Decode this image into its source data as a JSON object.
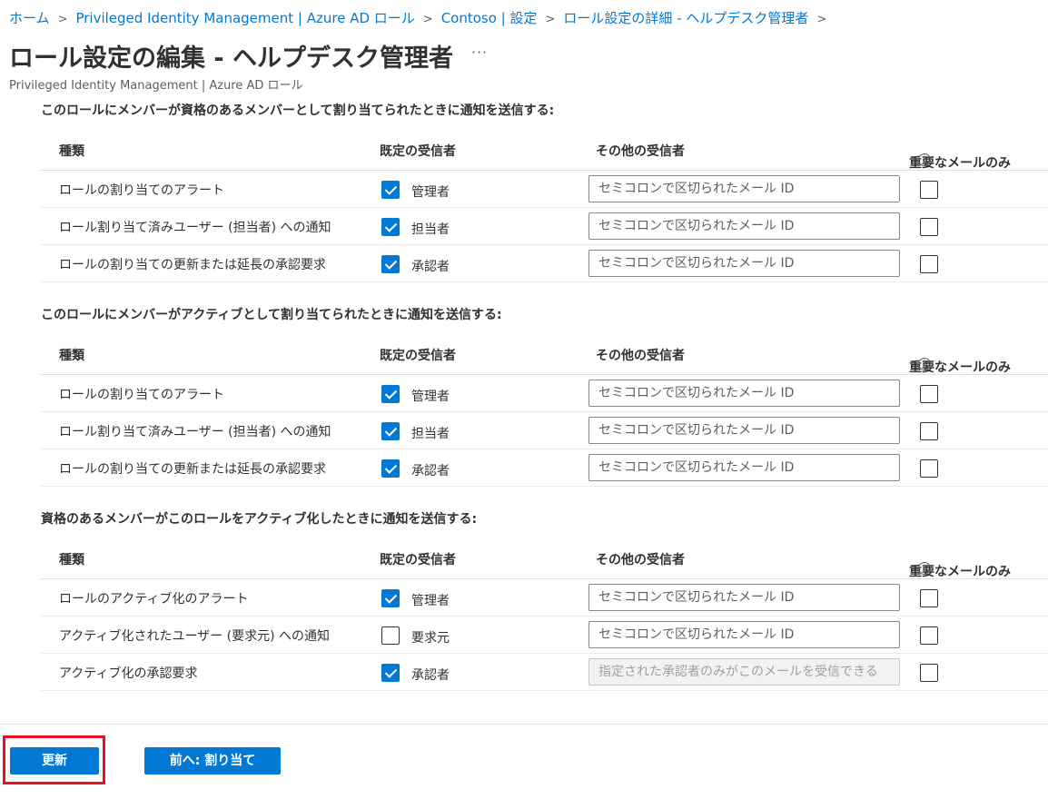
{
  "breadcrumb": [
    "ホーム",
    "Privileged Identity Management | Azure AD ロール",
    "Contoso | 設定",
    "ロール設定の詳細 - ヘルプデスク管理者"
  ],
  "breadcrumb_separator": ">",
  "title": "ロール設定の編集 - ヘルプデスク管理者",
  "more_label": "···",
  "subtitle": "Privileged Identity Management | Azure AD ロール",
  "columns": {
    "type": "種類",
    "default_recipients": "既定の受信者",
    "other_recipients": "その他の受信者",
    "critical_only": "重要なメールのみ"
  },
  "info_icon": "i",
  "sections": [
    {
      "title": "このロールにメンバーが資格のあるメンバーとして割り当てられたときに通知を送信する:",
      "rows": [
        {
          "type": "ロールの割り当てのアラート",
          "recipient": "管理者",
          "recipient_checked": true,
          "email_placeholder": "セミコロンで区切られたメール ID",
          "email_disabled": false,
          "critical": false
        },
        {
          "type": "ロール割り当て済みユーザー (担当者) への通知",
          "recipient": "担当者",
          "recipient_checked": true,
          "email_placeholder": "セミコロンで区切られたメール ID",
          "email_disabled": false,
          "critical": false
        },
        {
          "type": "ロールの割り当ての更新または延長の承認要求",
          "recipient": "承認者",
          "recipient_checked": true,
          "email_placeholder": "セミコロンで区切られたメール ID",
          "email_disabled": false,
          "critical": false
        }
      ]
    },
    {
      "title": "このロールにメンバーがアクティブとして割り当てられたときに通知を送信する:",
      "rows": [
        {
          "type": "ロールの割り当てのアラート",
          "recipient": "管理者",
          "recipient_checked": true,
          "email_placeholder": "セミコロンで区切られたメール ID",
          "email_disabled": false,
          "critical": false
        },
        {
          "type": "ロール割り当て済みユーザー (担当者) への通知",
          "recipient": "担当者",
          "recipient_checked": true,
          "email_placeholder": "セミコロンで区切られたメール ID",
          "email_disabled": false,
          "critical": false
        },
        {
          "type": "ロールの割り当ての更新または延長の承認要求",
          "recipient": "承認者",
          "recipient_checked": true,
          "email_placeholder": "セミコロンで区切られたメール ID",
          "email_disabled": false,
          "critical": false
        }
      ]
    },
    {
      "title": "資格のあるメンバーがこのロールをアクティブ化したときに通知を送信する:",
      "rows": [
        {
          "type": "ロールのアクティブ化のアラート",
          "recipient": "管理者",
          "recipient_checked": true,
          "email_placeholder": "セミコロンで区切られたメール ID",
          "email_disabled": false,
          "critical": false
        },
        {
          "type": "アクティブ化されたユーザー (要求元) への通知",
          "recipient": "要求元",
          "recipient_checked": false,
          "email_placeholder": "セミコロンで区切られたメール ID",
          "email_disabled": false,
          "critical": false
        },
        {
          "type": "アクティブ化の承認要求",
          "recipient": "承認者",
          "recipient_checked": true,
          "email_placeholder": "指定された承認者のみがこのメールを受信できる",
          "email_disabled": true,
          "critical": false
        }
      ]
    }
  ],
  "buttons": {
    "update": "更新",
    "previous": "前へ: 割り当て"
  },
  "colors": {
    "accent": "#0078d4",
    "link": "#0078d4",
    "highlight": "#e81123",
    "text": "#323130"
  }
}
